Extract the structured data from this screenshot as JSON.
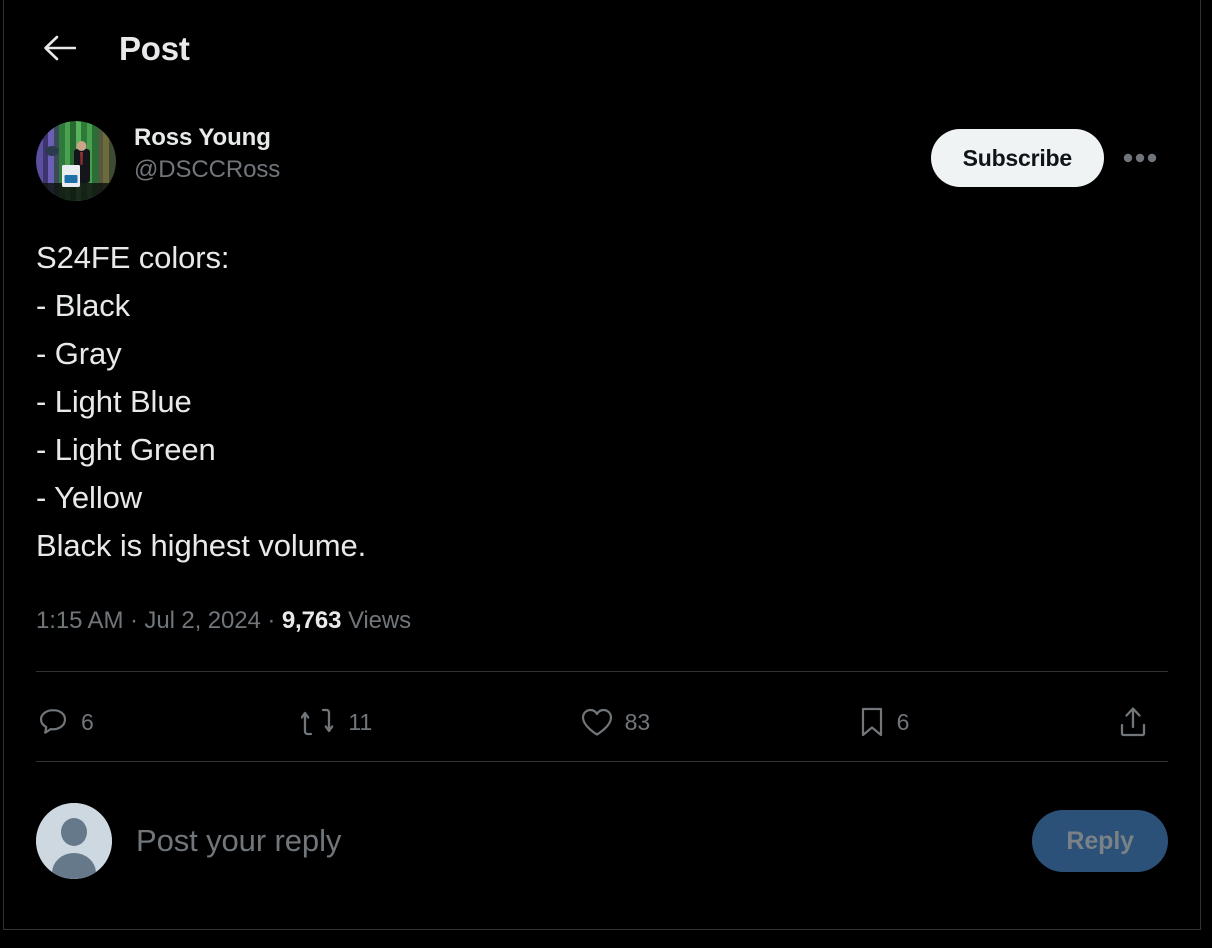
{
  "header": {
    "back_icon": "arrow-left-icon",
    "title": "Post"
  },
  "author": {
    "display_name": "Ross Young",
    "handle": "@DSCCRoss",
    "avatar_icon": "user-avatar-photo",
    "subscribe_label": "Subscribe",
    "more_icon": "more-horizontal-icon"
  },
  "post": {
    "lines": [
      "S24FE colors:",
      "- Black",
      "- Gray",
      "- Light Blue",
      "- Light Green",
      "- Yellow",
      "Black is highest volume."
    ],
    "meta": {
      "time": "1:15 AM",
      "separator_1": "·",
      "date": "Jul 2, 2024",
      "separator_2": "·",
      "views_count": "9,763",
      "views_label": "Views"
    }
  },
  "actions": [
    {
      "name": "reply",
      "icon": "comment-icon",
      "count": "6"
    },
    {
      "name": "repost",
      "icon": "retweet-icon",
      "count": "11"
    },
    {
      "name": "like",
      "icon": "heart-icon",
      "count": "83"
    },
    {
      "name": "bookmark",
      "icon": "bookmark-icon",
      "count": "6"
    },
    {
      "name": "share",
      "icon": "share-upload-icon",
      "count": ""
    }
  ],
  "reply_composer": {
    "avatar_icon": "default-avatar-icon",
    "placeholder": "Post your reply",
    "value": "",
    "reply_label": "Reply"
  },
  "colors": {
    "background": "#000000",
    "text_primary": "#e7e9ea",
    "text_secondary": "#71767b",
    "border": "#2f3336",
    "subscribe_bg": "#eff3f4",
    "reply_button_bg": "#2b5179",
    "reply_button_text": "#7a8187"
  }
}
